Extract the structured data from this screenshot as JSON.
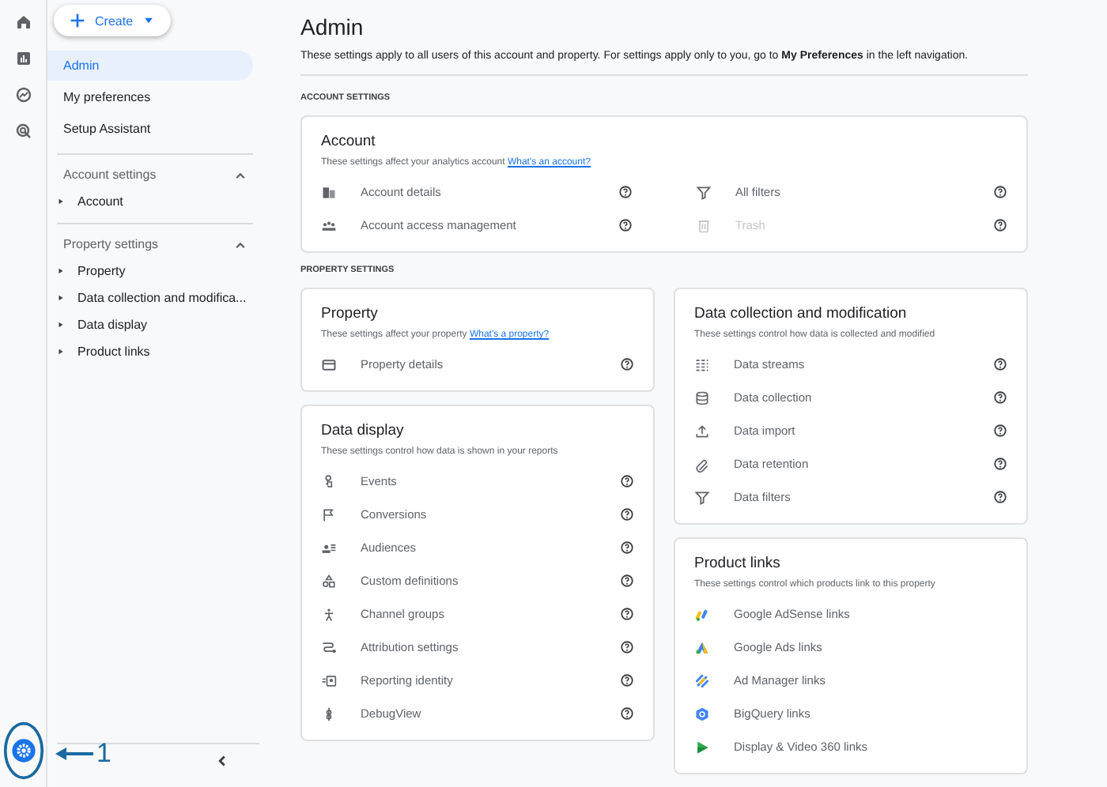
{
  "create_button": {
    "label": "Create"
  },
  "nav": {
    "items": [
      {
        "label": "Admin",
        "selected": true
      },
      {
        "label": "My preferences",
        "selected": false
      },
      {
        "label": "Setup Assistant",
        "selected": false
      }
    ],
    "groups": [
      {
        "title": "Account settings",
        "expanded": true,
        "children": [
          {
            "label": "Account"
          }
        ]
      },
      {
        "title": "Property settings",
        "expanded": true,
        "children": [
          {
            "label": "Property"
          },
          {
            "label": "Data collection and modifica..."
          },
          {
            "label": "Data display"
          },
          {
            "label": "Product links"
          }
        ]
      }
    ]
  },
  "page": {
    "title": "Admin",
    "description": "These settings apply to all users of this account and property. For settings apply only to you, go to **My Preferences** in the left navigation."
  },
  "account_section": {
    "heading": "ACCOUNT SETTINGS",
    "card": {
      "title": "Account",
      "description": "These settings affect your analytics account",
      "link": "What's an account?",
      "help_icons": true,
      "items": [
        {
          "label": "Account details",
          "disabled": false
        },
        {
          "label": "All filters",
          "disabled": false
        },
        {
          "label": "Account access management",
          "disabled": false
        },
        {
          "label": "Trash",
          "disabled": true
        }
      ]
    }
  },
  "property_section": {
    "heading": "PROPERTY SETTINGS",
    "columns": [
      [
        {
          "title": "Property",
          "description": "These settings affect your property",
          "link": "What's a property?",
          "help_icons": true,
          "items": [
            {
              "label": "Property details"
            }
          ]
        },
        {
          "title": "Data display",
          "description": "These settings control how data is shown in your reports",
          "help_icons": true,
          "items": [
            {
              "label": "Events"
            },
            {
              "label": "Conversions"
            },
            {
              "label": "Audiences"
            },
            {
              "label": "Custom definitions"
            },
            {
              "label": "Channel groups"
            },
            {
              "label": "Attribution settings"
            },
            {
              "label": "Reporting identity"
            },
            {
              "label": "DebugView"
            }
          ]
        }
      ],
      [
        {
          "title": "Data collection and modification",
          "description": "These settings control how data is collected and modified",
          "help_icons": true,
          "items": [
            {
              "label": "Data streams"
            },
            {
              "label": "Data collection"
            },
            {
              "label": "Data import"
            },
            {
              "label": "Data retention"
            },
            {
              "label": "Data filters"
            }
          ]
        },
        {
          "title": "Product links",
          "description": "These settings control which products link to this property",
          "help_icons": false,
          "items": [
            {
              "label": "Google AdSense links"
            },
            {
              "label": "Google Ads links"
            },
            {
              "label": "Ad Manager links"
            },
            {
              "label": "BigQuery links"
            },
            {
              "label": "Display & Video 360 links"
            }
          ]
        }
      ]
    ]
  },
  "annotation": {
    "label": "1"
  }
}
